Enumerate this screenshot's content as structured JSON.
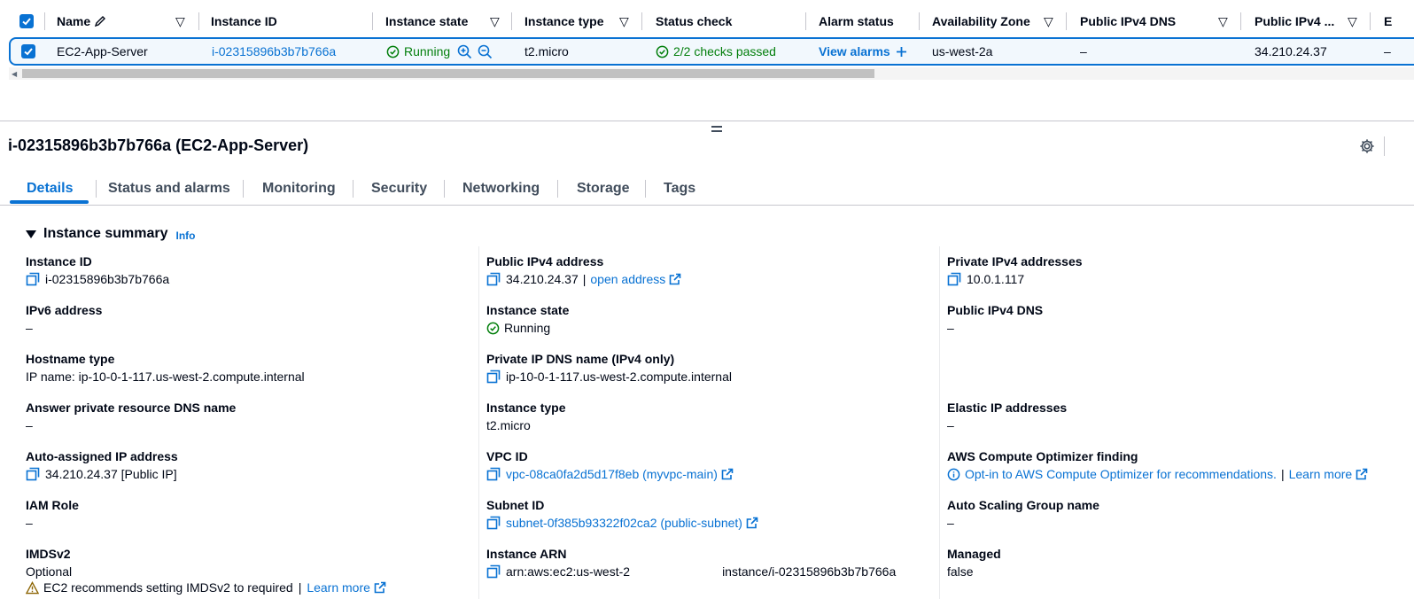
{
  "table": {
    "columns": [
      {
        "label": "Name"
      },
      {
        "label": "Instance ID"
      },
      {
        "label": "Instance state"
      },
      {
        "label": "Instance type"
      },
      {
        "label": "Status check"
      },
      {
        "label": "Alarm status"
      },
      {
        "label": "Availability Zone"
      },
      {
        "label": "Public IPv4 DNS"
      },
      {
        "label": "Public IPv4 ..."
      },
      {
        "label": "E"
      }
    ],
    "row": {
      "name": "EC2-App-Server",
      "instance_id": "i-02315896b3b7b766a",
      "state": "Running",
      "type": "t2.micro",
      "status_check": "2/2 checks passed",
      "alarm_link": "View alarms",
      "az": "us-west-2a",
      "public_dns": "–",
      "public_ip": "34.210.24.37",
      "last": "–"
    }
  },
  "panel": {
    "title": "i-02315896b3b7b766a (EC2-App-Server)",
    "tabs": [
      {
        "label": "Details"
      },
      {
        "label": "Status and alarms"
      },
      {
        "label": "Monitoring"
      },
      {
        "label": "Security"
      },
      {
        "label": "Networking"
      },
      {
        "label": "Storage"
      },
      {
        "label": "Tags"
      }
    ],
    "section_title": "Instance summary",
    "info_link": "Info",
    "col1": {
      "instance_id_label": "Instance ID",
      "instance_id_value": "i-02315896b3b7b766a",
      "ipv6_label": "IPv6 address",
      "ipv6_value": "–",
      "hostname_label": "Hostname type",
      "hostname_value": "IP name: ip-10-0-1-117.us-west-2.compute.internal",
      "answer_dns_label": "Answer private resource DNS name",
      "answer_dns_value": "–",
      "auto_ip_label": "Auto-assigned IP address",
      "auto_ip_value": "34.210.24.37 [Public IP]",
      "iam_label": "IAM Role",
      "iam_value": "–",
      "imds_label": "IMDSv2",
      "imds_value": "Optional",
      "imds_warning": "EC2 recommends setting IMDSv2 to required",
      "imds_learn": "Learn more"
    },
    "col2": {
      "public_ip_label": "Public IPv4 address",
      "public_ip_value": "34.210.24.37",
      "open_address": "open address",
      "state_label": "Instance state",
      "state_value": "Running",
      "private_dns_label": "Private IP DNS name (IPv4 only)",
      "private_dns_value": "ip-10-0-1-117.us-west-2.compute.internal",
      "type_label": "Instance type",
      "type_value": "t2.micro",
      "vpc_label": "VPC ID",
      "vpc_value": "vpc-08ca0fa2d5d17f8eb (myvpc-main)",
      "subnet_label": "Subnet ID",
      "subnet_value": "subnet-0f385b93322f02ca2 (public-subnet)",
      "arn_label": "Instance ARN",
      "arn_value_a": "arn:aws:ec2:us-west-2",
      "arn_value_b": "instance/i-02315896b3b7b766a"
    },
    "col3": {
      "private_ip_label": "Private IPv4 addresses",
      "private_ip_value": "10.0.1.117",
      "public_dns_label": "Public IPv4 DNS",
      "public_dns_value": "–",
      "eip_label": "Elastic IP addresses",
      "eip_value": "–",
      "optimizer_label": "AWS Compute Optimizer finding",
      "optimizer_link": "Opt-in to AWS Compute Optimizer for recommendations.",
      "optimizer_learn": "Learn more",
      "asg_label": "Auto Scaling Group name",
      "asg_value": "–",
      "managed_label": "Managed",
      "managed_value": "false"
    }
  },
  "colors": {
    "accent": "#0972d3",
    "success": "#037f0c",
    "warning": "#8d6605"
  }
}
